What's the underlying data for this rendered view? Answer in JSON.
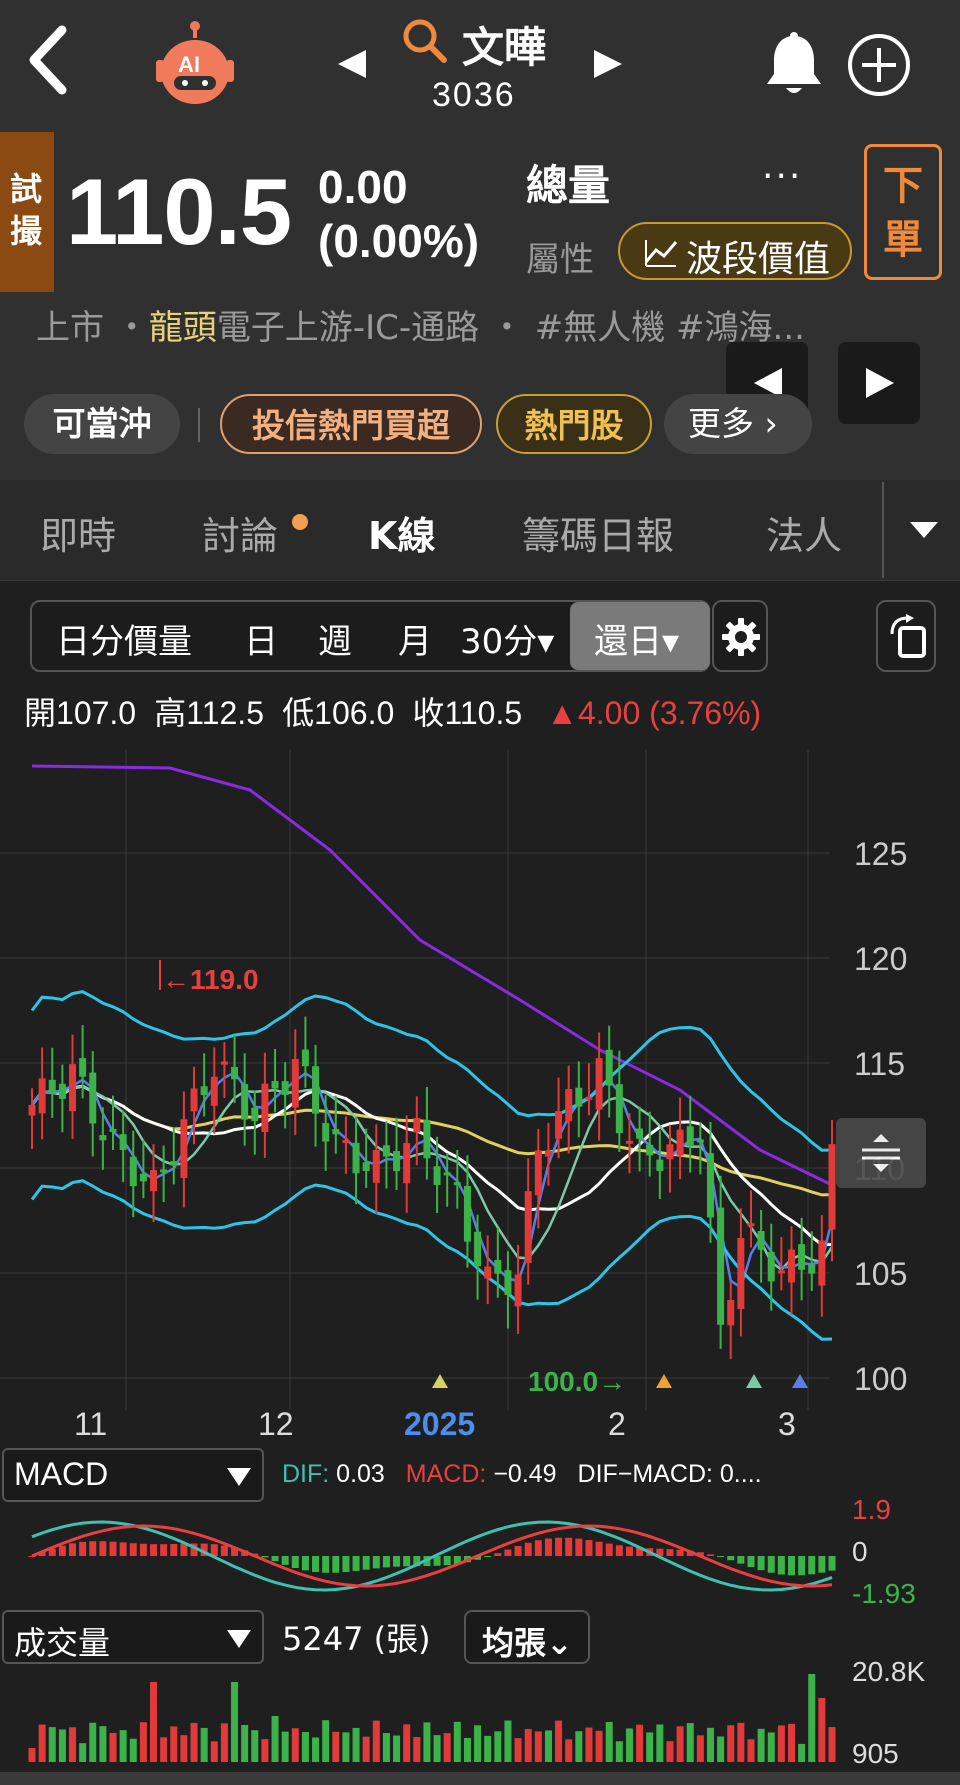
{
  "header": {
    "stock_name": "文曄",
    "stock_code": "3036",
    "ai_label": "AI"
  },
  "quote": {
    "trial_badge": "試撮",
    "price": "110.5",
    "change": "0.00",
    "change_pct": "(0.00%)",
    "total_volume_label": "總量",
    "more_dots": "···",
    "attribute_label": "屬性",
    "wave_value_button": "波段價值",
    "order_button": "下單",
    "tags_line_prefix": "上市 ・",
    "tags_line_highlight": "龍頭",
    "tags_line_rest": "電子上游-IC-通路 ・ #無人機  #鴻海..."
  },
  "chips": {
    "day_trade": "可當沖",
    "investment_trust": "投信熱門買超",
    "hot_stock": "熱門股",
    "more": "更多 ›"
  },
  "tabs": [
    "即時",
    "討論",
    "K線",
    "籌碼日報",
    "法人"
  ],
  "toolbar": {
    "items": [
      "日分價量",
      "日",
      "週",
      "月",
      "30分▾"
    ],
    "active": "還日▾"
  },
  "ohlc": {
    "open_label": "開",
    "open": "107.0",
    "high_label": "高",
    "high": "112.5",
    "low_label": "低",
    "low": "106.0",
    "close_label": "收",
    "close": "110.5",
    "delta": "▲4.00 (3.76%)"
  },
  "chart_data": {
    "type": "candlestick",
    "y_ticks": [
      "125",
      "120",
      "115",
      "110",
      "105",
      "100"
    ],
    "x_ticks": [
      "11",
      "12",
      "2025",
      "2",
      "3"
    ],
    "annotations": {
      "high_marker": "←119.0",
      "low_marker": "100.0→"
    },
    "ylim": [
      99,
      128
    ],
    "colors": {
      "up": "#e03a3a",
      "down": "#3cb24a",
      "ma_purple": "#8a2be2",
      "ma_yellow": "#e0d060",
      "ma_white": "#ffffff",
      "boll": "#2ec4e6",
      "ma_teal": "#7ec8a8",
      "ma_blue": "#5b7ee5"
    }
  },
  "macd": {
    "selector": "MACD",
    "dif_label": "DIF:",
    "dif": "0.03",
    "macd_label": "MACD:",
    "macd": "−0.49",
    "diff_label": "DIF−MACD: 0....",
    "y_ticks": [
      "1.9",
      "0",
      "-1.93"
    ]
  },
  "volume": {
    "selector": "成交量",
    "value": "5247 (張)",
    "avg_button": "均張⌄",
    "y_ticks": [
      "20.8K",
      "905"
    ]
  }
}
